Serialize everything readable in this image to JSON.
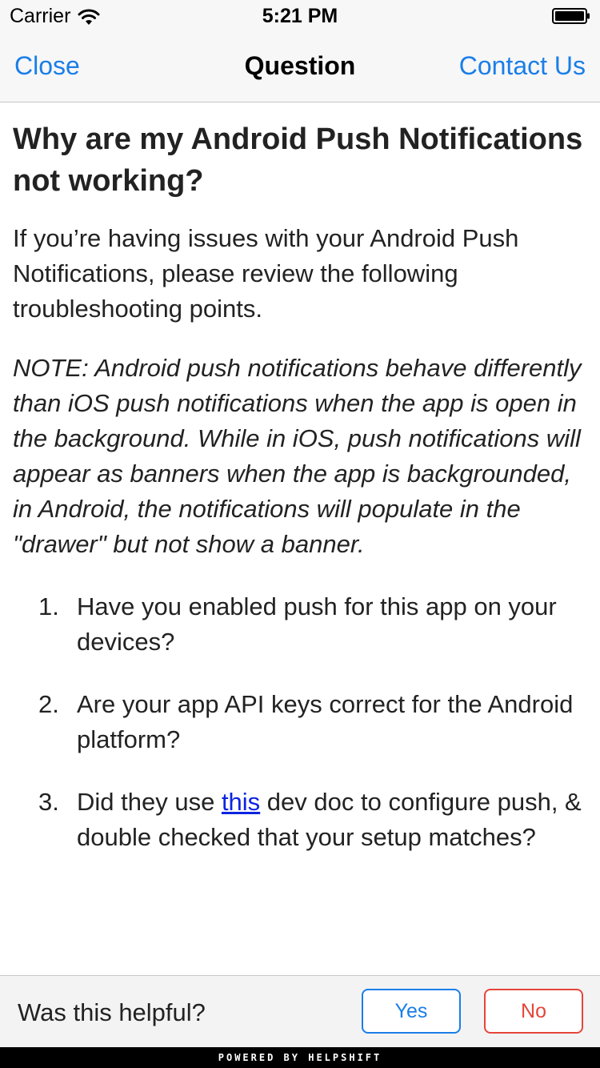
{
  "status_bar": {
    "carrier": "Carrier",
    "time": "5:21 PM",
    "icons": [
      "wifi-icon",
      "battery-icon"
    ]
  },
  "nav": {
    "close_label": "Close",
    "title": "Question",
    "contact_label": "Contact Us"
  },
  "article": {
    "title": "Why are my Android Push Notifications not working?",
    "intro": "If you’re having issues with your Android Push Notifications, please review the following troubleshooting points.",
    "note": "NOTE: Android push notifications behave differently than iOS push notifications when the app is open in the background. While in iOS, push notifications will appear as banners when the app is backgrounded, in Android, the notifications will populate in the \"drawer\" but not show a banner.",
    "steps": [
      {
        "num": "1.",
        "text": "Have you enabled push for this app on your devices?"
      },
      {
        "num": "2.",
        "text": "Are your app API keys correct for the Android platform?"
      },
      {
        "num": "3.",
        "before": "Did they use ",
        "link": "this",
        "after": " dev doc to configure push, & double checked that your setup matches?"
      }
    ]
  },
  "feedback": {
    "question": "Was this helpful?",
    "yes_label": "Yes",
    "no_label": "No"
  },
  "footer": {
    "powered_by": "POWERED BY HELPSHIFT"
  },
  "colors": {
    "accent": "#1a7ee8",
    "danger": "#e5463b",
    "link": "#0b24e0"
  }
}
